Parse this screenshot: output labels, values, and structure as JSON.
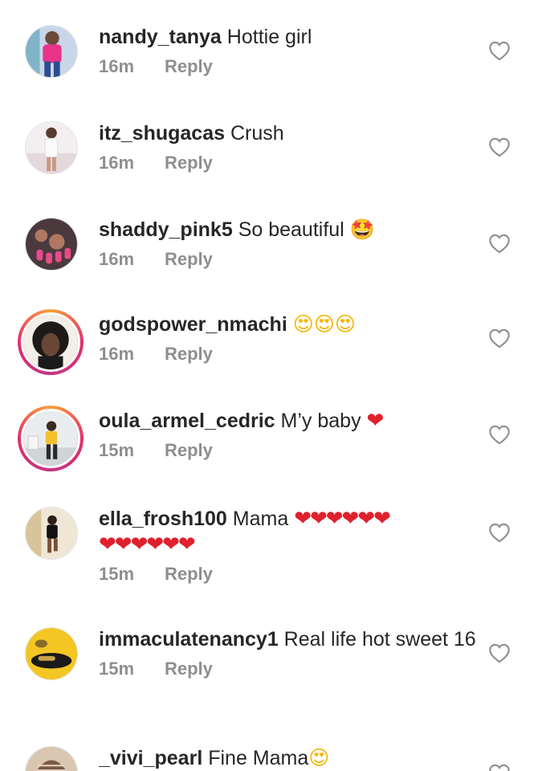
{
  "comments": [
    {
      "username": "nandy_tanya",
      "text": "Hottie girl",
      "emoji": "",
      "time": "16m",
      "reply_label": "Reply",
      "like_icon": "heart-outline-icon"
    },
    {
      "username": "itz_shugacas",
      "text": "Crush",
      "emoji": "",
      "time": "16m",
      "reply_label": "Reply",
      "like_icon": "heart-outline-icon"
    },
    {
      "username": "shaddy_pink5",
      "text": "So beautiful",
      "emoji": "🤩",
      "time": "16m",
      "reply_label": "Reply",
      "like_icon": "heart-outline-icon"
    },
    {
      "username": "godspower_nmachi",
      "text": "",
      "emoji": "😍😍😍",
      "time": "16m",
      "reply_label": "Reply",
      "like_icon": "heart-outline-icon"
    },
    {
      "username": "oula_armel_cedric",
      "text": "M’y baby",
      "emoji": "❤",
      "time": "15m",
      "reply_label": "Reply",
      "like_icon": "heart-outline-icon"
    },
    {
      "username": "ella_frosh100",
      "text": "Mama",
      "emoji": "❤❤❤❤❤❤",
      "emoji_line2": "❤❤❤❤❤❤",
      "time": "15m",
      "reply_label": "Reply",
      "like_icon": "heart-outline-icon"
    },
    {
      "username": "immaculatenancy1",
      "text": "Real life hot sweet 16",
      "emoji": "",
      "time": "15m",
      "reply_label": "Reply",
      "like_icon": "heart-outline-icon"
    },
    {
      "username": "_vivi_pearl",
      "text": "Fine Mama",
      "emoji": "😍",
      "time": "",
      "reply_label": "",
      "like_icon": "heart-outline-icon"
    }
  ],
  "colors": {
    "text": "#262626",
    "meta": "#8e8e8e",
    "heart_emoji": "#e0202d",
    "story_ring": "#e1306c"
  }
}
